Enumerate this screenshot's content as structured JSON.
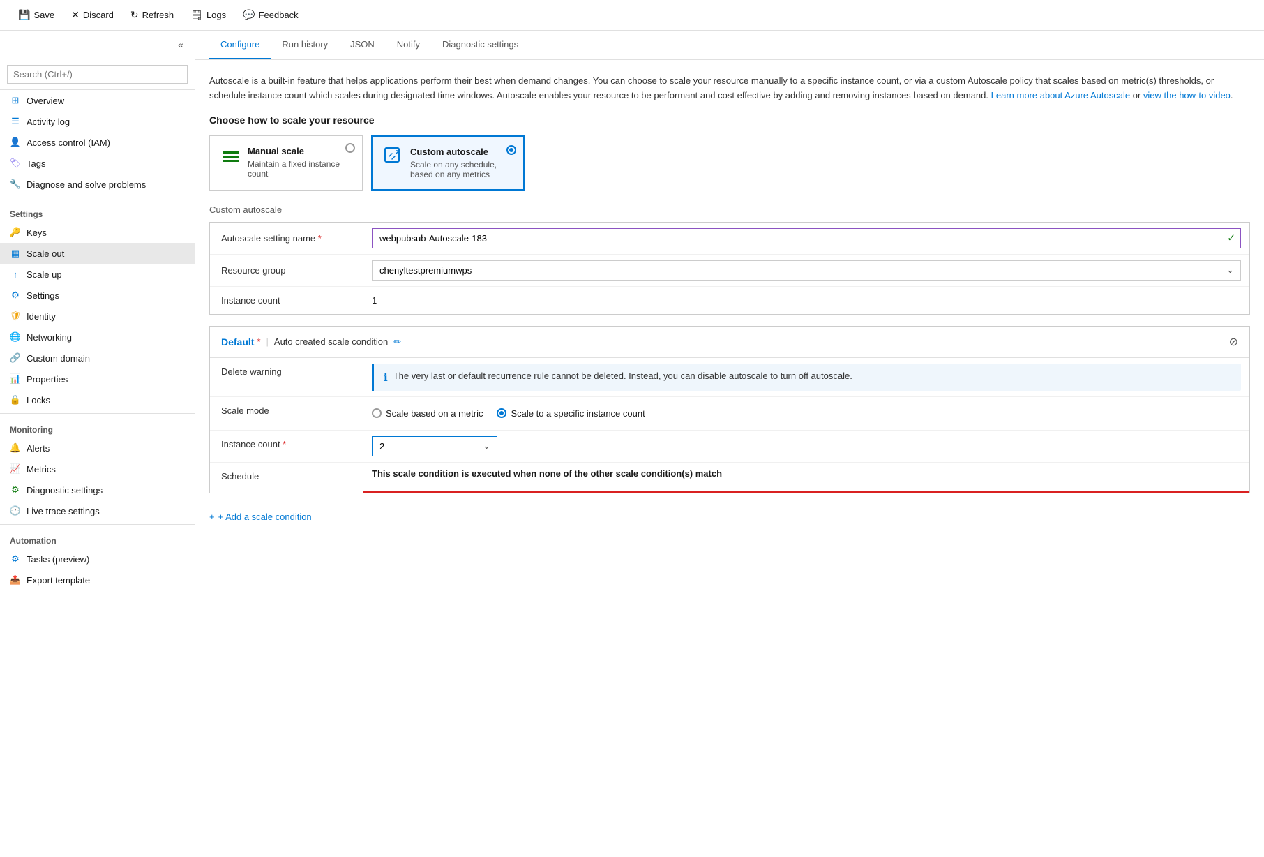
{
  "toolbar": {
    "save_label": "Save",
    "discard_label": "Discard",
    "refresh_label": "Refresh",
    "logs_label": "Logs",
    "feedback_label": "Feedback"
  },
  "sidebar": {
    "search_placeholder": "Search (Ctrl+/)",
    "items": [
      {
        "id": "overview",
        "label": "Overview",
        "icon": "grid"
      },
      {
        "id": "activity-log",
        "label": "Activity log",
        "icon": "list"
      },
      {
        "id": "access-control",
        "label": "Access control (IAM)",
        "icon": "person"
      },
      {
        "id": "tags",
        "label": "Tags",
        "icon": "tag"
      },
      {
        "id": "diagnose",
        "label": "Diagnose and solve problems",
        "icon": "wrench"
      }
    ],
    "settings_label": "Settings",
    "settings_items": [
      {
        "id": "keys",
        "label": "Keys",
        "icon": "key"
      },
      {
        "id": "scale-out",
        "label": "Scale out",
        "icon": "table",
        "active": true
      },
      {
        "id": "scale-up",
        "label": "Scale up",
        "icon": "arrow-up"
      },
      {
        "id": "settings",
        "label": "Settings",
        "icon": "gear"
      },
      {
        "id": "identity",
        "label": "Identity",
        "icon": "shield"
      },
      {
        "id": "networking",
        "label": "Networking",
        "icon": "network"
      },
      {
        "id": "custom-domain",
        "label": "Custom domain",
        "icon": "domain"
      },
      {
        "id": "properties",
        "label": "Properties",
        "icon": "bar-chart"
      },
      {
        "id": "locks",
        "label": "Locks",
        "icon": "lock"
      }
    ],
    "monitoring_label": "Monitoring",
    "monitoring_items": [
      {
        "id": "alerts",
        "label": "Alerts",
        "icon": "alert"
      },
      {
        "id": "metrics",
        "label": "Metrics",
        "icon": "metrics"
      },
      {
        "id": "diagnostic-settings",
        "label": "Diagnostic settings",
        "icon": "settings"
      },
      {
        "id": "live-trace",
        "label": "Live trace settings",
        "icon": "clock"
      }
    ],
    "automation_label": "Automation",
    "automation_items": [
      {
        "id": "tasks",
        "label": "Tasks (preview)",
        "icon": "tasks"
      },
      {
        "id": "export-template",
        "label": "Export template",
        "icon": "export"
      }
    ]
  },
  "tabs": [
    {
      "id": "configure",
      "label": "Configure",
      "active": true
    },
    {
      "id": "run-history",
      "label": "Run history"
    },
    {
      "id": "json",
      "label": "JSON"
    },
    {
      "id": "notify",
      "label": "Notify"
    },
    {
      "id": "diagnostic-settings",
      "label": "Diagnostic settings"
    }
  ],
  "description": {
    "text": "Autoscale is a built-in feature that helps applications perform their best when demand changes. You can choose to scale your resource manually to a specific instance count, or via a custom Autoscale policy that scales based on metric(s) thresholds, or schedule instance count which scales during designated time windows. Autoscale enables your resource to be performant and cost effective by adding and removing instances based on demand.",
    "link1_text": "Learn more about Azure Autoscale",
    "link1_url": "#",
    "link2_text": "view the how-to video",
    "link2_url": "#"
  },
  "scale": {
    "heading": "Choose how to scale your resource",
    "manual": {
      "title": "Manual scale",
      "description": "Maintain a fixed instance count",
      "selected": false
    },
    "custom": {
      "title": "Custom autoscale",
      "description": "Scale on any schedule, based on any metrics",
      "selected": true
    }
  },
  "custom_autoscale_label": "Custom autoscale",
  "form": {
    "setting_name_label": "Autoscale setting name",
    "setting_name_value": "webpubsub-Autoscale-183",
    "resource_group_label": "Resource group",
    "resource_group_value": "chenyltestpremiumwps",
    "resource_group_options": [
      "chenyltestpremiumwps"
    ],
    "instance_count_label": "Instance count",
    "instance_count_value": "1"
  },
  "condition": {
    "title": "Default",
    "asterisk": "*",
    "subtitle": "Auto created scale condition",
    "delete_warning_label": "Delete warning",
    "delete_warning_message": "The very last or default recurrence rule cannot be deleted. Instead, you can disable autoscale to turn off autoscale.",
    "scale_mode_label": "Scale mode",
    "scale_mode_option1": "Scale based on a metric",
    "scale_mode_option2": "Scale to a specific instance count",
    "scale_mode_selected": "option2",
    "instance_count_label": "Instance count",
    "instance_count_req": "*",
    "instance_count_value": "2",
    "schedule_label": "Schedule",
    "schedule_message": "This scale condition is executed when none of the other scale condition(s) match"
  },
  "add_condition": "+ Add a scale condition"
}
